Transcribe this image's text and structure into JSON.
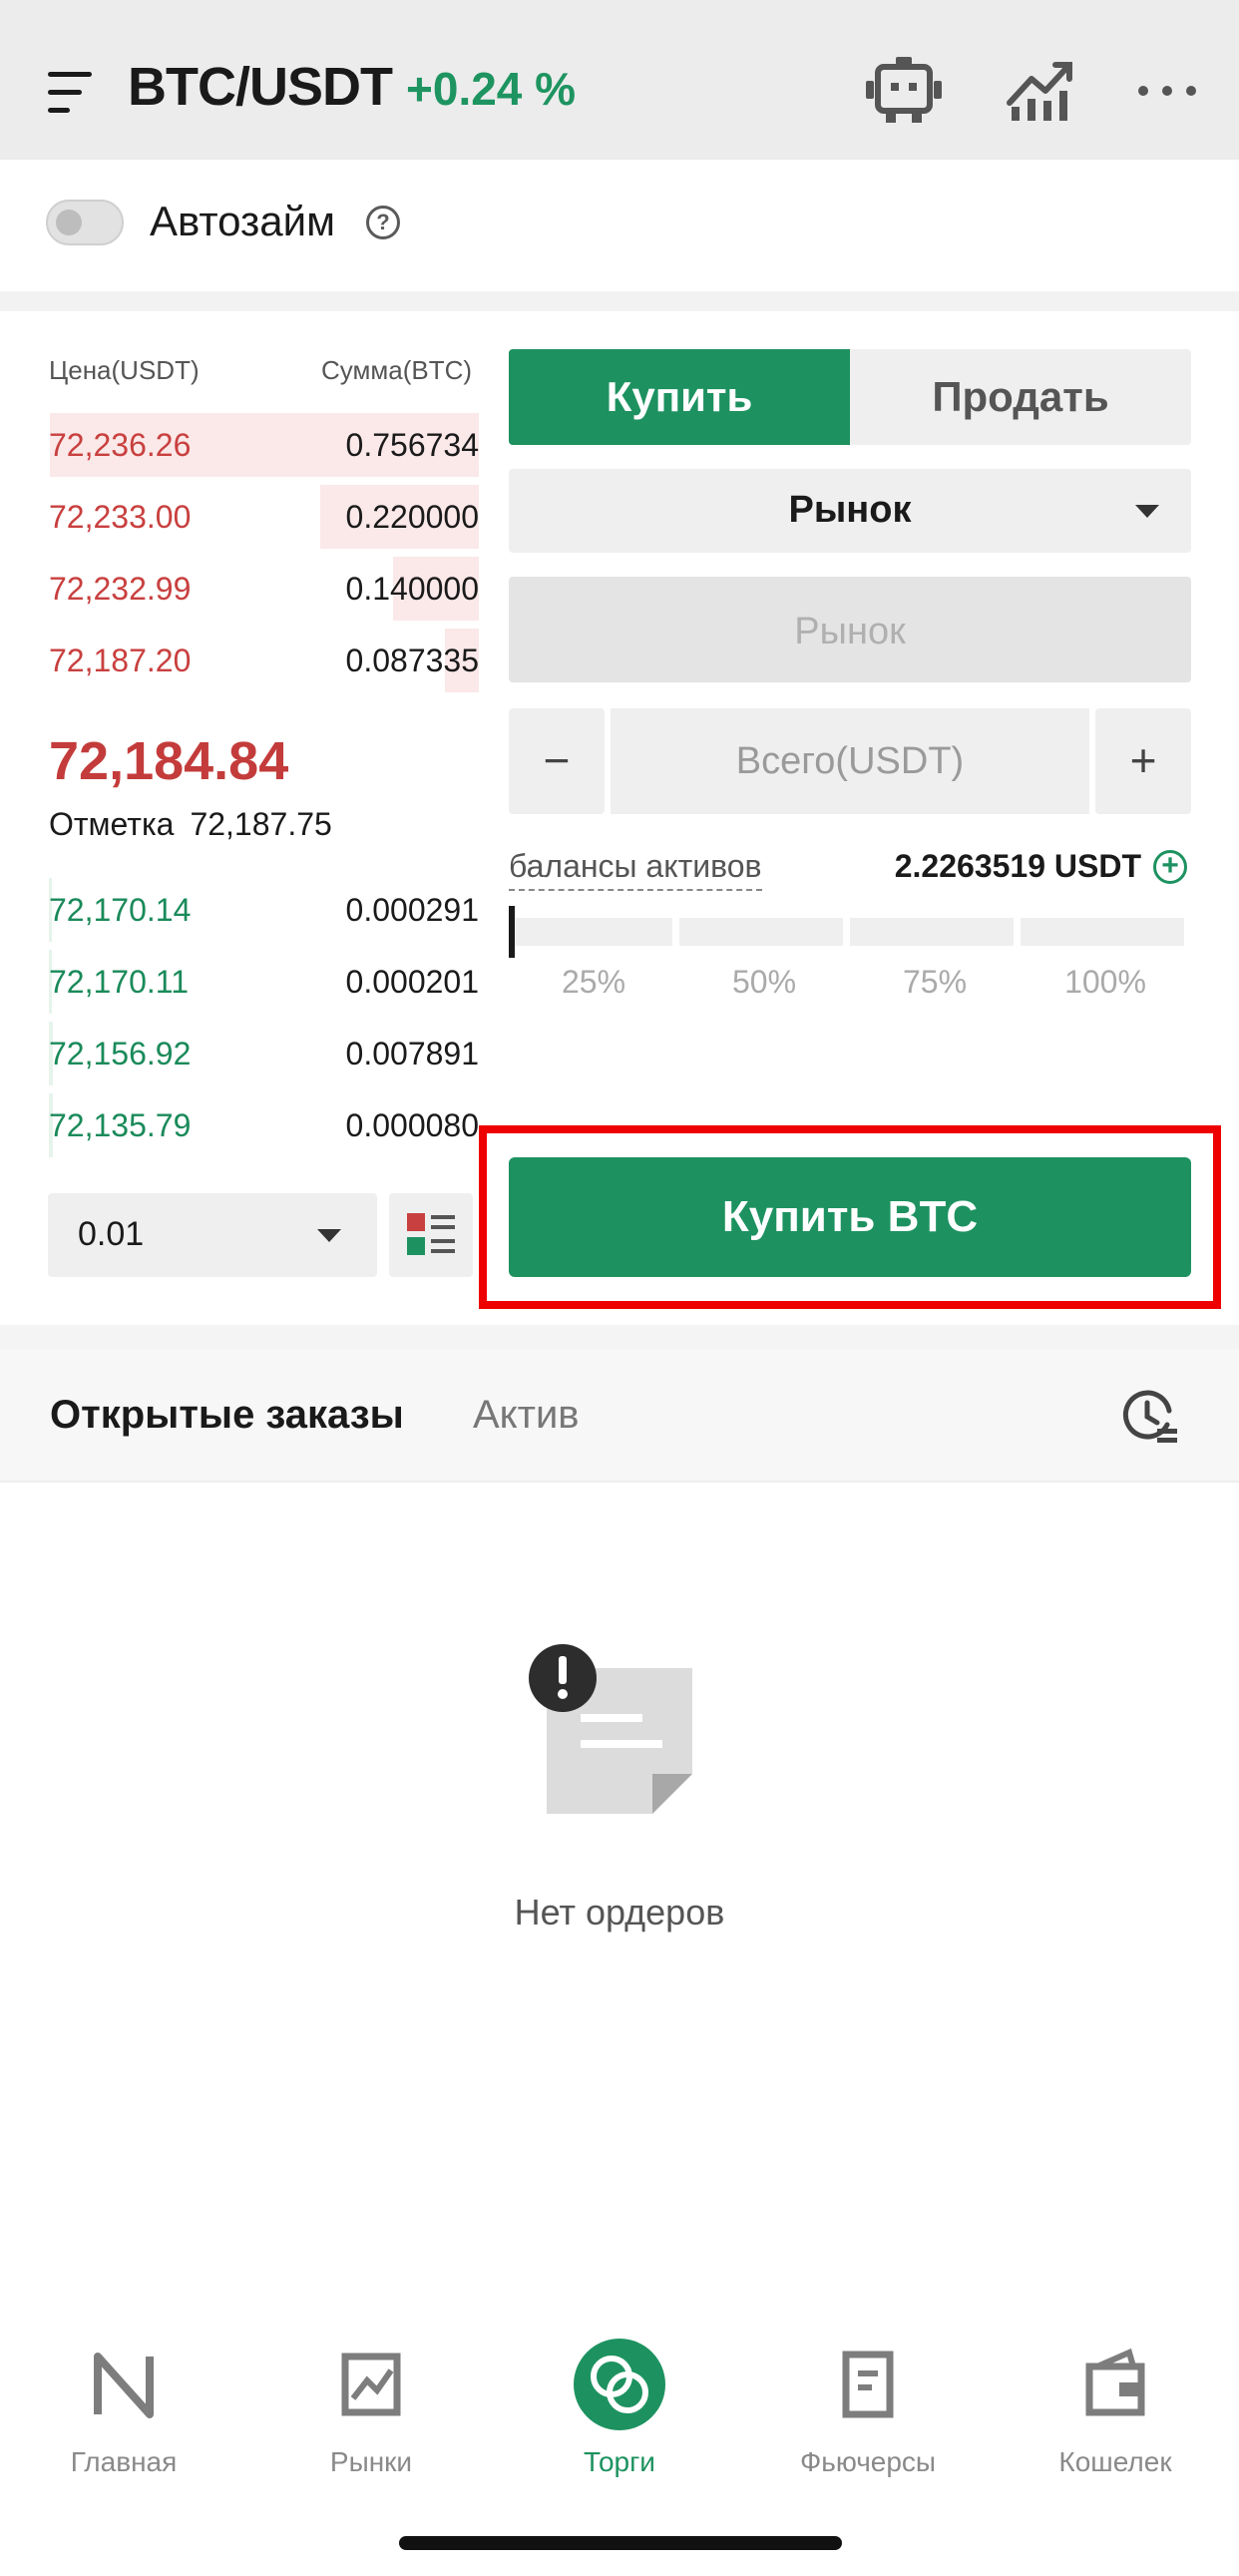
{
  "header": {
    "pair": "BTC/USDT",
    "change": "+0.24 %",
    "icons": [
      "menu-icon",
      "robot-icon",
      "chart-icon",
      "more-icon"
    ]
  },
  "autoloan": {
    "label": "Автозайм",
    "help": "?",
    "enabled": false
  },
  "orderbook": {
    "price_header": "Цена(USDT)",
    "amount_header": "Сумма(BTC)",
    "asks": [
      {
        "price": "72,236.26",
        "amount": "0.756734",
        "depth": 1.0
      },
      {
        "price": "72,233.00",
        "amount": "0.220000",
        "depth": 0.37
      },
      {
        "price": "72,232.99",
        "amount": "0.140000",
        "depth": 0.2
      },
      {
        "price": "72,187.20",
        "amount": "0.087335",
        "depth": 0.08
      }
    ],
    "last_price": "72,184.84",
    "mark_label": "Отметка",
    "mark_value": "72,187.75",
    "bids": [
      {
        "price": "72,170.14",
        "amount": "0.000291",
        "depth": 0.0
      },
      {
        "price": "72,170.11",
        "amount": "0.000201",
        "depth": 0.0
      },
      {
        "price": "72,156.92",
        "amount": "0.007891",
        "depth": 0.01
      },
      {
        "price": "72,135.79",
        "amount": "0.000080",
        "depth": 0.01
      }
    ],
    "precision": "0.01"
  },
  "trade": {
    "buy_tab": "Купить",
    "sell_tab": "Продать",
    "order_type": "Рынок",
    "price_placeholder": "Рынок",
    "minus": "−",
    "plus": "+",
    "total_placeholder": "Всего(USDT)",
    "balance_label": "балансы активов",
    "balance_value": "2.2263519 USDT",
    "percentages": [
      "25%",
      "50%",
      "75%",
      "100%"
    ],
    "slider_value": 0,
    "buy_button": "Купить BTC"
  },
  "orders": {
    "tab_open": "Открытые заказы",
    "tab_asset": "Актив",
    "empty_text": "Нет ордеров"
  },
  "nav": [
    {
      "label": "Главная",
      "icon": "home-icon"
    },
    {
      "label": "Рынки",
      "icon": "markets-icon"
    },
    {
      "label": "Торги",
      "icon": "trade-icon",
      "active": true
    },
    {
      "label": "Фьючерсы",
      "icon": "futures-icon"
    },
    {
      "label": "Кошелек",
      "icon": "wallet-icon"
    }
  ],
  "colors": {
    "accent_green": "#1d9260",
    "ask_red": "#c8403f",
    "highlight_red": "#ee0000"
  }
}
